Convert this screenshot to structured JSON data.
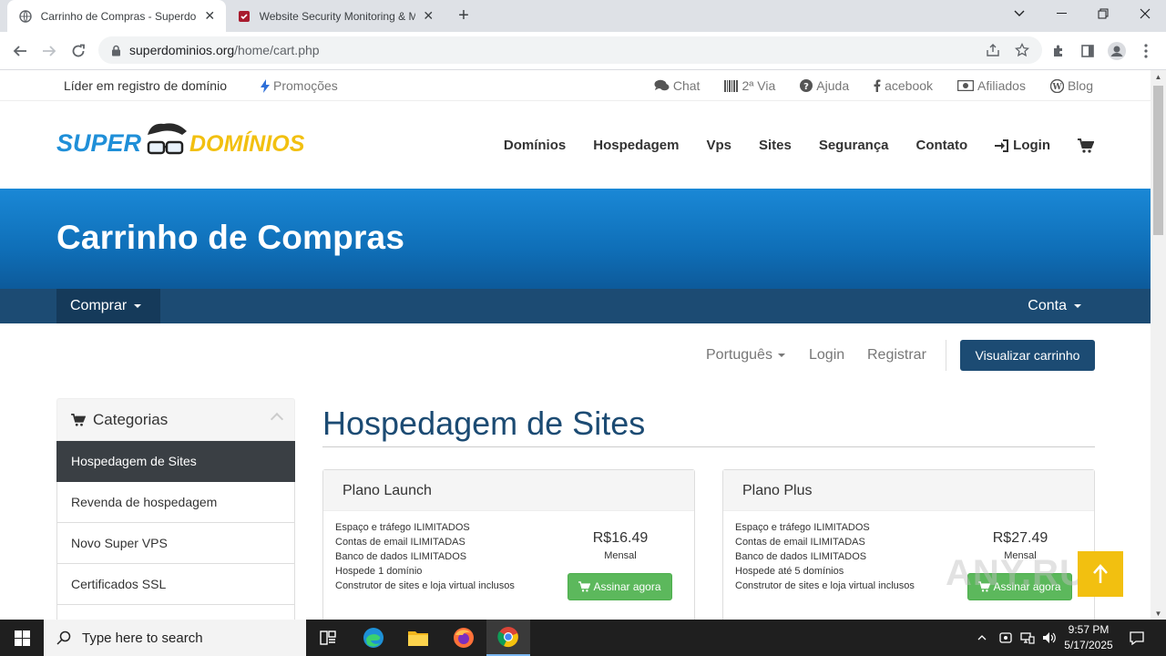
{
  "browser": {
    "tabs": [
      {
        "title": "Carrinho de Compras - Superdo",
        "active": true
      },
      {
        "title": "Website Security Monitoring & M",
        "active": false
      }
    ],
    "url_domain": "superdominios.org",
    "url_path": "/home/cart.php"
  },
  "topbar": {
    "tagline": "Líder em registro de domínio",
    "promo": "Promoções",
    "links": [
      "Chat",
      "2ª Via",
      "Ajuda",
      "acebook",
      "Afiliados",
      "Blog"
    ]
  },
  "logo": {
    "part1": "SUPER",
    "part2": "DOMÍNIOS"
  },
  "mainnav": [
    "Domínios",
    "Hospedagem",
    "Vps",
    "Sites",
    "Segurança",
    "Contato",
    "Login"
  ],
  "hero": {
    "title": "Carrinho de Compras"
  },
  "subnav": {
    "left": "Comprar",
    "right": "Conta"
  },
  "langbar": {
    "language": "Português",
    "login": "Login",
    "register": "Registrar",
    "view_cart": "Visualizar carrinho"
  },
  "sidebar": {
    "heading": "Categorias",
    "items": [
      "Hospedagem de Sites",
      "Revenda de hospedagem",
      "Novo Super VPS",
      "Certificados SSL"
    ]
  },
  "content": {
    "heading": "Hospedagem de Sites",
    "plans": [
      {
        "name": "Plano Launch",
        "features": [
          "Espaço e tráfego ILIMITADOS",
          "Contas de email ILIMITADAS",
          "Banco de dados ILIMITADOS",
          "Hospede 1 domínio",
          "Construtor de sites e loja virtual inclusos"
        ],
        "price": "R$16.49",
        "cycle": "Mensal",
        "button": "Assinar agora"
      },
      {
        "name": "Plano Plus",
        "features": [
          "Espaço e tráfego ILIMITADOS",
          "Contas de email ILIMITADAS",
          "Banco de dados ILIMITADOS",
          "Hospede até 5 domínios",
          "Construtor de sites e loja virtual inclusos"
        ],
        "price": "R$27.49",
        "cycle": "Mensal",
        "button": "Assinar agora"
      }
    ]
  },
  "watermark": "ANY.RUN",
  "taskbar": {
    "search_placeholder": "Type here to search",
    "time": "9:57 PM",
    "date": "5/17/2025"
  },
  "colors": {
    "brand_dark": "#1c4b73",
    "hero_blue": "#1a88d6",
    "buy_green": "#5cb85c",
    "logo_blue": "#1f8fd8",
    "logo_yellow": "#f2c010"
  }
}
